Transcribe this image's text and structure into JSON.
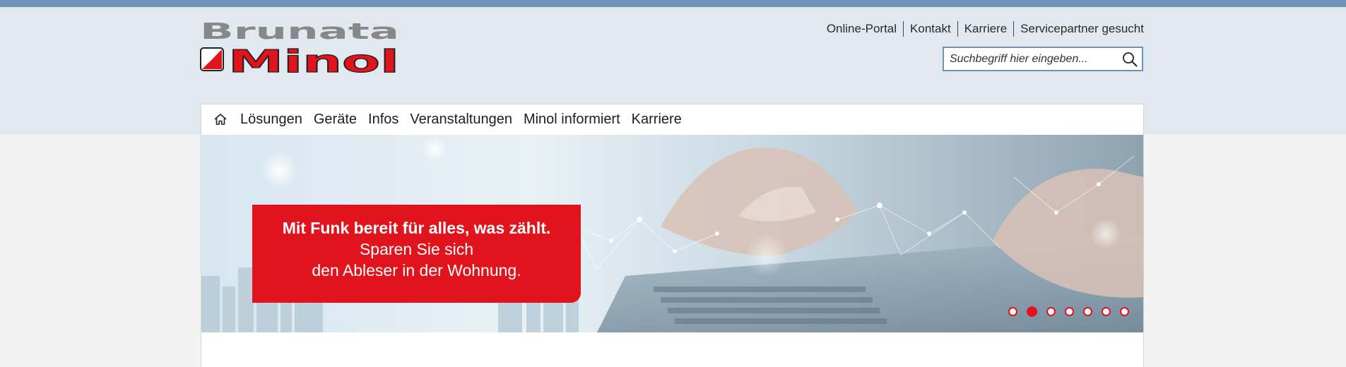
{
  "brand": {
    "logo_top": "Brunata",
    "logo_bottom": "Minol",
    "logo_top_color": "#888888",
    "logo_bottom_color": "#e1141e"
  },
  "utility_nav": [
    {
      "label": "Online-Portal"
    },
    {
      "label": "Kontakt"
    },
    {
      "label": "Karriere"
    },
    {
      "label": "Servicepartner gesucht"
    }
  ],
  "search": {
    "placeholder": "Suchbegriff hier eingeben...",
    "value": "",
    "icon": "search-icon"
  },
  "main_nav": {
    "home_icon": "home-icon",
    "items": [
      {
        "label": "Lösungen"
      },
      {
        "label": "Geräte"
      },
      {
        "label": "Infos"
      },
      {
        "label": "Veranstaltungen"
      },
      {
        "label": "Minol informiert"
      },
      {
        "label": "Karriere"
      }
    ]
  },
  "hero": {
    "headline": "Mit Funk bereit für alles, was zählt.",
    "subline_1": "Sparen Sie sich",
    "subline_2": "den Ableser in der Wohnung.",
    "slide_count": 7,
    "active_slide": 2
  },
  "colors": {
    "accent_red": "#e1141e",
    "topbar_blue": "#6d93b6",
    "header_bg": "#e1e8ef"
  }
}
